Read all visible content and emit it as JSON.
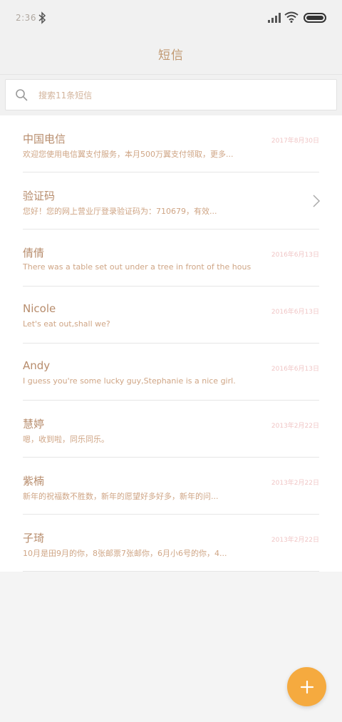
{
  "status_bar": {
    "time": "2:36",
    "icons": [
      "bluetooth-icon",
      "signal-icon",
      "wifi-icon",
      "battery-icon"
    ]
  },
  "header": {
    "title": "短信"
  },
  "search": {
    "placeholder": "搜索11条短信"
  },
  "conversations": [
    {
      "name": "中国电信",
      "date": "2017年8月30日",
      "preview": "欢迎您使用电信翼支付服务，本月500万翼支付领取，更多..."
    },
    {
      "name": "验证码",
      "date": "",
      "preview": "您好！您的网上营业厅登录验证码为：710679，有效..."
    },
    {
      "name": "倩倩",
      "date": "2016年6月13日",
      "preview": "There was a table set out under a tree in front of the hous"
    },
    {
      "name": "Nicole",
      "date": "2016年6月13日",
      "preview": "Let's eat out,shall we?"
    },
    {
      "name": "Andy",
      "date": "2016年6月13日",
      "preview": "I guess you're some lucky guy,Stephanie is a nice girl."
    },
    {
      "name": "慧婷",
      "date": "2013年2月22日",
      "preview": "嗯，收到啦，同乐同乐。"
    },
    {
      "name": "紫楠",
      "date": "2013年2月22日",
      "preview": "新年的祝福数不胜数，新年的愿望好多好多，新年的问..."
    },
    {
      "name": "子琦",
      "date": "2013年2月22日",
      "preview": "10月是田9月的你，8张邮票7张邮你，6月小6号的你，4..."
    }
  ],
  "colors": {
    "accent": "#f5aa3f",
    "text_primary": "#b78c6c",
    "text_secondary": "#cfa585",
    "date": "#f0c6c6"
  },
  "fab": {
    "icon": "plus-icon"
  }
}
